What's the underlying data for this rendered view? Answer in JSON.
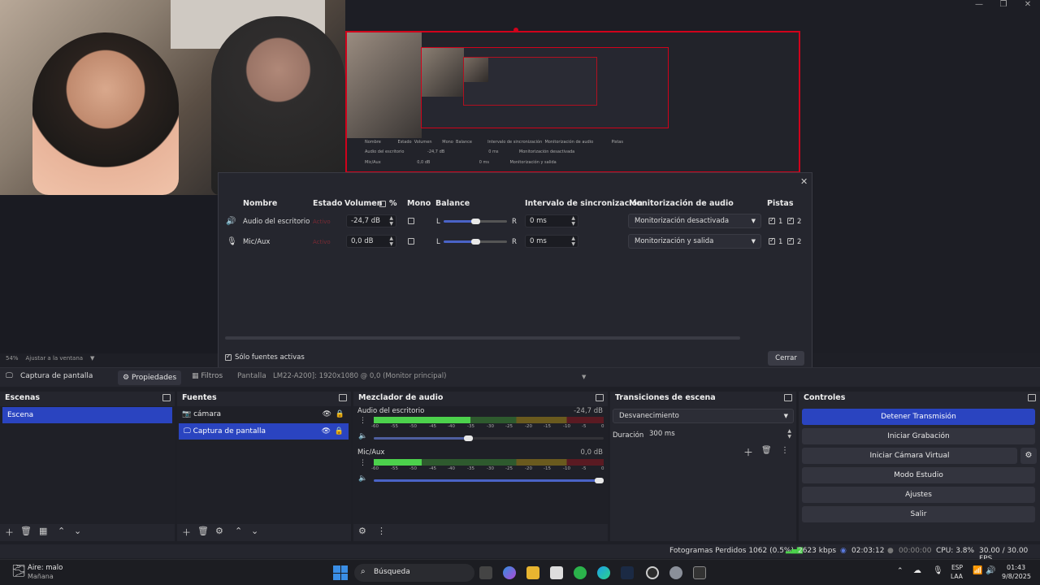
{
  "window": {
    "controls": [
      "—",
      "❐",
      "✕"
    ]
  },
  "preview": {
    "zoom": "54%",
    "zoom_mode": "Ajustar a la ventana",
    "nested_mixer": {
      "headers": [
        "Nombre",
        "Estado",
        "Volumen",
        "%",
        "Mono",
        "Balance",
        "Intervalo de sincronización",
        "Monitorización de audio",
        "Pistas"
      ],
      "rows": [
        {
          "name": "Audio del escritorio",
          "vol": "-24,7 dB",
          "sync": "0 ms",
          "monitor": "Monitorización desactivada"
        },
        {
          "name": "Mic/Aux",
          "vol": "0,0 dB",
          "sync": "0 ms",
          "monitor": "Monitorización y salida"
        }
      ]
    }
  },
  "dialog": {
    "close": "✕",
    "headers": {
      "name": "Nombre",
      "state": "Estado",
      "volume": "Volumen",
      "percent": "%",
      "mono": "Mono",
      "balance": "Balance",
      "sync": "Intervalo de sincronización",
      "monitor": "Monitorización de audio",
      "tracks": "Pistas"
    },
    "rows": [
      {
        "name": "Audio del escritorio",
        "state": "Activo",
        "volume": "-24,7 dB",
        "bal_l": "L",
        "bal_r": "R",
        "sync": "0 ms",
        "monitor": "Monitorización desactivada",
        "t1": "1",
        "t2": "2"
      },
      {
        "name": "Mic/Aux",
        "state": "Activo",
        "volume": "0,0 dB",
        "bal_l": "L",
        "bal_r": "R",
        "sync": "0 ms",
        "monitor": "Monitorización y salida",
        "t1": "1",
        "t2": "2"
      }
    ],
    "only_active": "Sólo fuentes activas",
    "close_button": "Cerrar"
  },
  "sourcebar": {
    "source": "Captura de pantalla",
    "properties": "Propiedades",
    "filters": "Filtros",
    "screen_label": "Pantalla",
    "screen_value": "LM22-A200]: 1920x1080 @ 0,0 (Monitor principal)"
  },
  "scenes": {
    "title": "Escenas",
    "items": [
      "Escena"
    ]
  },
  "sources": {
    "title": "Fuentes",
    "items": [
      "cámara",
      "Captura de pantalla"
    ]
  },
  "mixer": {
    "title": "Mezclador de audio",
    "channels": [
      {
        "name": "Audio del escritorio",
        "db": "-24,7 dB",
        "fill": 0.42,
        "vol": 0.43
      },
      {
        "name": "Mic/Aux",
        "db": "0,0 dB",
        "fill": 0.21,
        "vol": 1.0
      }
    ],
    "scale": [
      "-60",
      "-55",
      "-50",
      "-45",
      "-40",
      "-35",
      "-30",
      "-25",
      "-20",
      "-15",
      "-10",
      "-5",
      "0"
    ]
  },
  "transitions": {
    "title": "Transiciones de escena",
    "selected": "Desvanecimiento",
    "duration_label": "Duración",
    "duration": "300 ms"
  },
  "controls": {
    "title": "Controles",
    "buttons": [
      "Detener Transmisión",
      "Iniciar Grabación",
      "Iniciar Cámara Virtual",
      "Modo Estudio",
      "Ajustes",
      "Salir"
    ]
  },
  "status": {
    "dropped": "Fotogramas Perdidos 1062 (0.5%)",
    "bitrate": "2623 kbps",
    "stream_time": "02:03:12",
    "rec_time": "00:00:00",
    "cpu": "CPU: 3.8%",
    "fps": "30.00 / 30.00 FPS"
  },
  "taskbar": {
    "weather": "Aire: malo",
    "weather_sub": "Mañana",
    "search": "Búsqueda",
    "lang": "ESP",
    "lang_sub": "LAA",
    "time": "01:43",
    "date": "9/8/2025"
  }
}
